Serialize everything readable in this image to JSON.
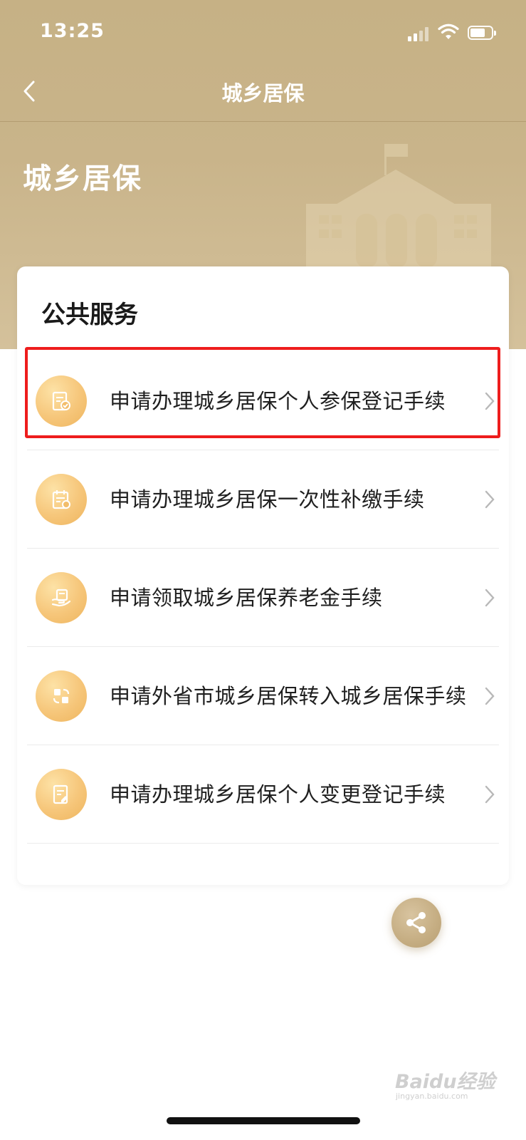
{
  "status_bar": {
    "time": "13:25"
  },
  "nav": {
    "title": "城乡居保",
    "back_icon": "chevron-left-icon"
  },
  "hero": {
    "title": "城乡居保",
    "illustration": "building-icon"
  },
  "section": {
    "title": "公共服务",
    "items": [
      {
        "label": "申请办理城乡居保个人参保登记手续",
        "icon": "document-check-icon",
        "highlighted": true
      },
      {
        "label": "申请办理城乡居保一次性补缴手续",
        "icon": "calendar-document-icon",
        "highlighted": false
      },
      {
        "label": "申请领取城乡居保养老金手续",
        "icon": "hand-receive-icon",
        "highlighted": false
      },
      {
        "label": "申请外省市城乡居保转入城乡居保手续",
        "icon": "transfer-icon",
        "highlighted": false
      },
      {
        "label": "申请办理城乡居保个人变更登记手续",
        "icon": "document-edit-icon",
        "highlighted": false
      }
    ]
  },
  "share_button": {
    "icon": "share-icon"
  },
  "watermark": {
    "text": "Baidu经验",
    "sub": "jingyan.baidu.com"
  },
  "colors": {
    "header": "#c9b48a",
    "icon_gold": "#f6c67a",
    "highlight": "#ee1d1d",
    "text": "#1f1f1f"
  }
}
